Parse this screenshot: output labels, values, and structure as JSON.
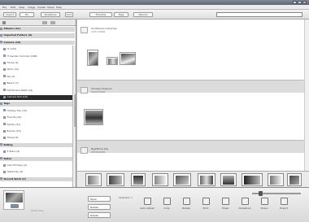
{
  "window": {
    "title": ""
  },
  "menu": {
    "items": [
      "File",
      "Edit",
      "View",
      "Image",
      "Create",
      "Share",
      "Help"
    ]
  },
  "toolbar": {
    "buttons": [
      "Import",
      "Fix",
      "Slideshow",
      "Sort",
      "Timeline",
      "Tags",
      "Albums"
    ],
    "search_placeholder": ""
  },
  "sidebar": {
    "header": "",
    "items": [
      {
        "label": "Albums (12)",
        "kind": "group"
      },
      {
        "label": "Imported Folders (9)",
        "kind": "group"
      },
      {
        "label": "Camera (18)",
        "kind": "group"
      },
      {
        "label": "IT (104)",
        "kind": "item"
      },
      {
        "label": "IT Garden Summer 2006",
        "kind": "item"
      },
      {
        "label": "Home (4)",
        "kind": "item"
      },
      {
        "label": "Work (12)",
        "kind": "item"
      },
      {
        "label": "Ski (3)",
        "kind": "item"
      },
      {
        "label": "Beach (7)",
        "kind": "item"
      },
      {
        "label": "Fall Photos 2006 (14)",
        "kind": "item"
      },
      {
        "label": "Camera Roll (18)",
        "kind": "selected"
      },
      {
        "label": "Tags",
        "kind": "group"
      },
      {
        "label": "Holiday Trip (12)",
        "kind": "item"
      },
      {
        "label": "Friends (44)",
        "kind": "item"
      },
      {
        "label": "Family (31)",
        "kind": "item"
      },
      {
        "label": "Events (23)",
        "kind": "item"
      },
      {
        "label": "Travel (8)",
        "kind": "item"
      },
      {
        "label": "Rating",
        "kind": "group"
      },
      {
        "label": "5 Stars (4)",
        "kind": "item"
      },
      {
        "label": "Dates",
        "kind": "group"
      },
      {
        "label": "Last 30 Days (2)",
        "kind": "item"
      },
      {
        "label": "Yesterday (9)",
        "kind": "item"
      },
      {
        "label": "Recent Work (3)",
        "kind": "group"
      }
    ]
  },
  "groups": [
    {
      "title": "Sunflowers Collection",
      "date": "10/17/2006"
    },
    {
      "title": "Chicago Museum",
      "date": "09/21/2006"
    },
    {
      "title": "Nighttime Sky",
      "date": "08/30/2006"
    }
  ],
  "bottom": {
    "caption": "Photo Tray",
    "mini_buttons": [
      "Open",
      "Rotate",
      "Delete"
    ],
    "mid_label": "Selected: 1",
    "actions": [
      "Auto Adjust",
      "Crop",
      "Rotate",
      "Print",
      "Email",
      "Slideshow",
      "Share",
      "Export"
    ]
  }
}
